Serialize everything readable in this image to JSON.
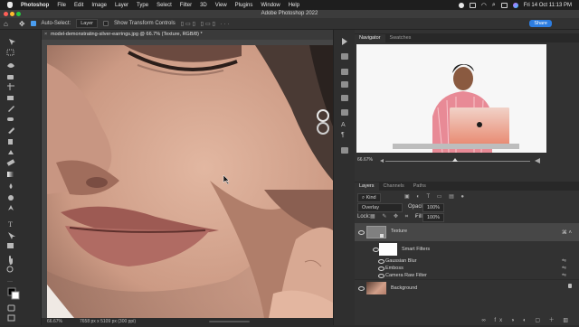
{
  "menubar": {
    "app_name": "Photoshop",
    "items": [
      "File",
      "Edit",
      "Image",
      "Layer",
      "Type",
      "Select",
      "Filter",
      "3D",
      "View",
      "Plugins",
      "Window",
      "Help"
    ],
    "clock": "Fri 14 Oct  11:13 PM"
  },
  "window": {
    "title": "Adobe Photoshop 2022"
  },
  "options": {
    "auto_select_label": "Auto-Select:",
    "auto_select_value": "Layer",
    "show_transform_label": "Show Transform Controls",
    "share_label": "Share"
  },
  "document": {
    "tab_title": "model-demonstrating-silver-earrings.jpg @ 66.7% (Texture, RGB/8) *",
    "zoom": "66.67%",
    "size_info": "7658 px x 5109 px (300 ppi)"
  },
  "navigator": {
    "tabs": [
      "Navigator",
      "Swatches"
    ],
    "zoom": "66.67%"
  },
  "layers_panel": {
    "tabs": [
      "Layers",
      "Channels",
      "Paths"
    ],
    "filter_kind": "Kind",
    "blend_mode": "Overlay",
    "opacity_label": "Opacity:",
    "opacity_value": "100%",
    "lock_label": "Lock:",
    "fill_label": "Fill:",
    "fill_value": "100%",
    "layers": {
      "texture": "Texture",
      "smart_filters": "Smart Filters",
      "filters": [
        "Gaussian Blur",
        "Emboss",
        "Camera Raw Filter"
      ],
      "background": "Background"
    }
  },
  "colors": {
    "accent": "#2d7de0",
    "skin": "#d4a590",
    "panel": "#323232"
  }
}
